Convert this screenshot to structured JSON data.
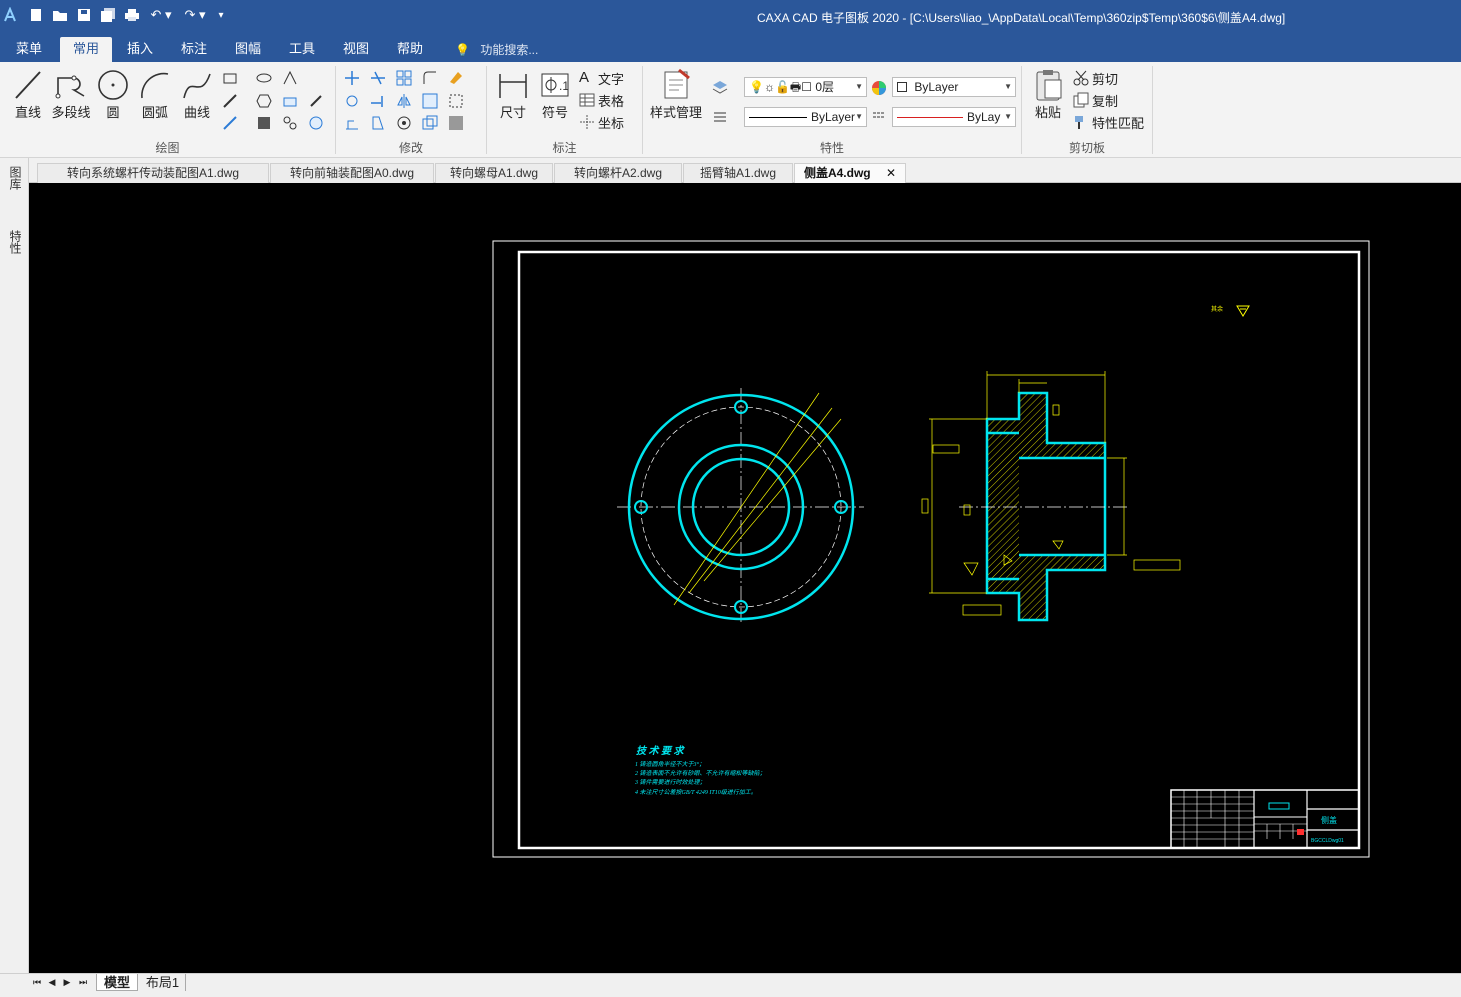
{
  "window": {
    "title": "CAXA CAD 电子图板 2020 - [C:\\Users\\liao_\\AppData\\Local\\Temp\\360zip$Temp\\360$6\\侧盖A4.dwg]"
  },
  "menu": {
    "tabs": [
      "菜单",
      "常用",
      "插入",
      "标注",
      "图幅",
      "工具",
      "视图",
      "帮助"
    ],
    "search_placeholder": "功能搜索..."
  },
  "ribbon": {
    "draw": {
      "label": "绘图",
      "line": "直线",
      "polyline": "多段线",
      "circle": "圆",
      "arc": "圆弧",
      "curve": "曲线"
    },
    "modify": {
      "label": "修改"
    },
    "annotate": {
      "label": "标注",
      "dimension": "尺寸",
      "symbol": "符号",
      "text": "文字",
      "table": "表格",
      "coord": "坐标"
    },
    "properties": {
      "label": "特性",
      "style_manager": "样式管理",
      "layer": "0层",
      "color": "ByLayer",
      "linetype": "ByLayer",
      "lineweight": "ByLay"
    },
    "clipboard": {
      "label": "剪切板",
      "paste": "粘贴",
      "cut": "剪切",
      "copy": "复制",
      "match": "特性匹配"
    }
  },
  "side_tabs": [
    "图库",
    "特性"
  ],
  "doc_tabs": [
    {
      "label": "转向系统螺杆传动装配图A1.dwg",
      "active": false
    },
    {
      "label": "转向前轴装配图A0.dwg",
      "active": false
    },
    {
      "label": "转向螺母A1.dwg",
      "active": false
    },
    {
      "label": "转向螺杆A2.dwg",
      "active": false
    },
    {
      "label": "摇臂轴A1.dwg",
      "active": false
    },
    {
      "label": "侧盖A4.dwg",
      "active": true
    }
  ],
  "drawing": {
    "tech_title": "技 术 要 求",
    "tech_items": [
      "1  铸造圆角半径不大于3°；",
      "2  铸造表面不允许有砂眼、不允许有缩松等缺陷；",
      "3  铸件需要进行时效处理；",
      "4  未注尺寸公差按GB/T 4249  IT10级进行加工。"
    ],
    "roughness_note": "其余",
    "part_name": "侧盖",
    "drawing_code": "BGCCLDwg01",
    "colors": {
      "outline": "#00e5ee",
      "dimension": "#ffff00",
      "frame": "#ffffff",
      "background": "#000000"
    }
  },
  "layout_tabs": [
    "模型",
    "布局1"
  ]
}
